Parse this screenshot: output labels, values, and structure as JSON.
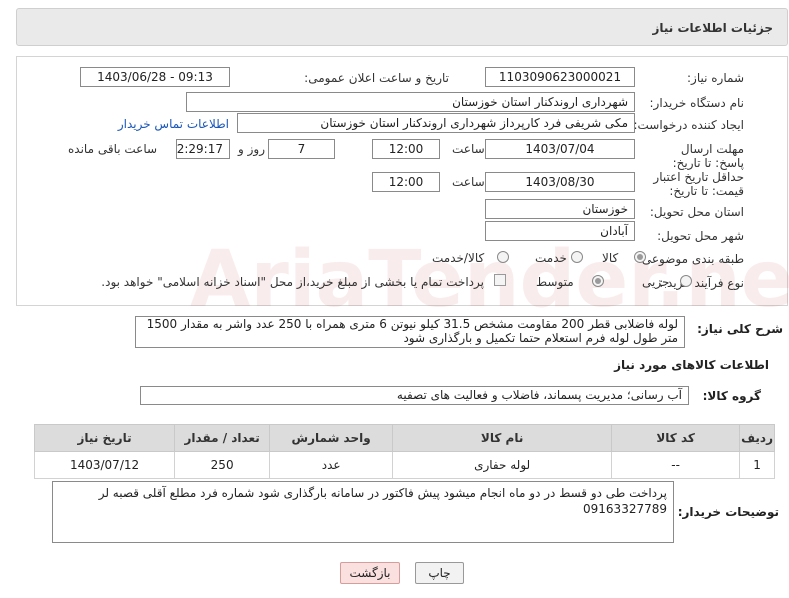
{
  "header": {
    "title": "جزئیات اطلاعات نیاز"
  },
  "need_number": {
    "label": "شماره نیاز:",
    "value": "1103090623000021"
  },
  "announce": {
    "label": "تاریخ و ساعت اعلان عمومی:",
    "value": "1403/06/28 - 09:13"
  },
  "buyer_org": {
    "label": "نام دستگاه خریدار:",
    "value": "شهرداری اروندکنار استان خوزستان"
  },
  "requester": {
    "label": "ایجاد کننده درخواست:",
    "value": "مکی شریفی فرد کارپرداز شهرداری اروندکنار استان خوزستان",
    "contact_link": "اطلاعات تماس خریدار"
  },
  "deadline": {
    "label": "مهلت ارسال پاسخ: تا تاریخ:",
    "date": "1403/07/04",
    "time_label": "ساعت",
    "time": "12:00",
    "days": "7",
    "days_label": "روز و",
    "remaining": "02:29:17",
    "remaining_label": "ساعت باقی مانده"
  },
  "validity": {
    "label": "حداقل تاریخ اعتبار قیمت: تا تاریخ:",
    "date": "1403/08/30",
    "time_label": "ساعت",
    "time": "12:00"
  },
  "delivery_province": {
    "label": "استان محل تحویل:",
    "value": "خوزستان"
  },
  "delivery_city": {
    "label": "شهر محل تحویل:",
    "value": "آبادان"
  },
  "category": {
    "label": "طبقه بندی موضوعی:",
    "options": [
      "کالا",
      "خدمت",
      "کالا/خدمت"
    ],
    "selected": "کالا"
  },
  "process": {
    "label": "نوع فرآیند خرید :",
    "options": [
      "جزیی",
      "متوسط"
    ],
    "selected": "متوسط",
    "checkbox_text": "پرداخت تمام یا بخشی از مبلغ خرید،از محل \"اسناد خزانه اسلامی\" خواهد بود."
  },
  "summary": {
    "label": "شرح کلی نیاز:",
    "value": "لوله فاضلابی قطر 200 مقاومت مشخص 31.5 کیلو نیوتن 6 متری همراه با 250 عدد واشر به مقدار 1500 متر طول لوله فرم استعلام حتما تکمیل و بارگذاری شود"
  },
  "goods_info_title": "اطلاعات کالاهای مورد نیاز",
  "goods_group": {
    "label": "گروه کالا:",
    "value": "آب رسانی؛ مدیریت پسماند، فاضلاب و فعالیت های تصفیه"
  },
  "table": {
    "headers": [
      "ردیف",
      "کد کالا",
      "نام کالا",
      "واحد شمارش",
      "تعداد / مقدار",
      "تاریخ نیاز"
    ],
    "rows": [
      [
        "1",
        "--",
        "لوله حفاری",
        "عدد",
        "250",
        "1403/07/12"
      ]
    ]
  },
  "buyer_notes": {
    "label": "توضیحات خریدار:",
    "value": "پرداخت طی دو قسط در دو ماه انجام میشود پیش فاکتور در سامانه بارگذاری شود شماره فرد مطلع آقلی قصبه لر 09163327789"
  },
  "buttons": {
    "print": "چاپ",
    "back": "بازگشت"
  },
  "watermark_text": "AriaTender.neT"
}
